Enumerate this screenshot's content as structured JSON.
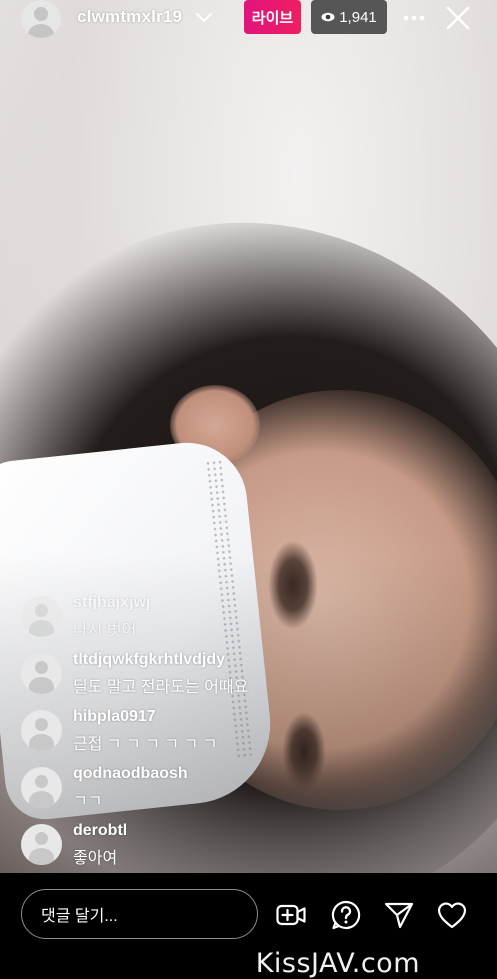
{
  "header": {
    "username": "clwmtmxlr19",
    "live_label": "라이브",
    "viewer_count": "1,941"
  },
  "comments": [
    {
      "username": "stfjhajxjwj",
      "text": "나시 벗어"
    },
    {
      "username": "tltdjqwkfgkrhtlvdjdy",
      "text": "딜도 말고 전라도는 어때요"
    },
    {
      "username": "hibpla0917",
      "text": "근접 ㄱ ㄱ ㄱ ㄱ ㄱ  ㄱ"
    },
    {
      "username": "qodnaodbaosh",
      "text": "ㄱㄱ"
    },
    {
      "username": "derobtl",
      "text": "좋아여"
    }
  ],
  "bottom_bar": {
    "comment_placeholder": "댓글 달기..."
  },
  "watermark": "KissJAV.com",
  "colors": {
    "live_badge": "#e1137e",
    "viewer_badge": "#3c3c3c",
    "background": "#000000"
  },
  "icons": [
    "chevron-down-icon",
    "eye-icon",
    "more-icon",
    "close-icon",
    "add-video-icon",
    "question-icon",
    "send-icon",
    "heart-icon"
  ]
}
